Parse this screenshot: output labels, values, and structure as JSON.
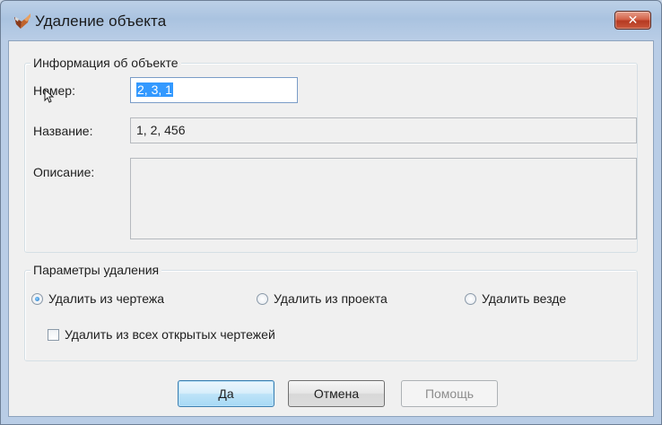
{
  "window": {
    "title": "Удаление объекта",
    "close_glyph": "✕",
    "icon": "app-icon"
  },
  "info_group": {
    "legend": "Информация об объекте",
    "number_label": "Номер:",
    "number_value": "2, 3, 1",
    "name_label": "Название:",
    "name_value": "1, 2, 456",
    "description_label": "Описание:",
    "description_value": ""
  },
  "delete_params": {
    "legend": "Параметры удаления",
    "options": [
      {
        "label": "Удалить из чертежа",
        "checked": true
      },
      {
        "label": "Удалить из проекта",
        "checked": false
      },
      {
        "label": "Удалить везде",
        "checked": false
      }
    ],
    "all_open_label": "Удалить из всех открытых чертежей",
    "all_open_checked": false
  },
  "buttons": {
    "yes": "Да",
    "cancel": "Отмена",
    "help": "Помощь"
  },
  "colors": {
    "selection": "#3399ff",
    "close_button": "#c9573c",
    "default_button_border": "#3c7fb1"
  }
}
